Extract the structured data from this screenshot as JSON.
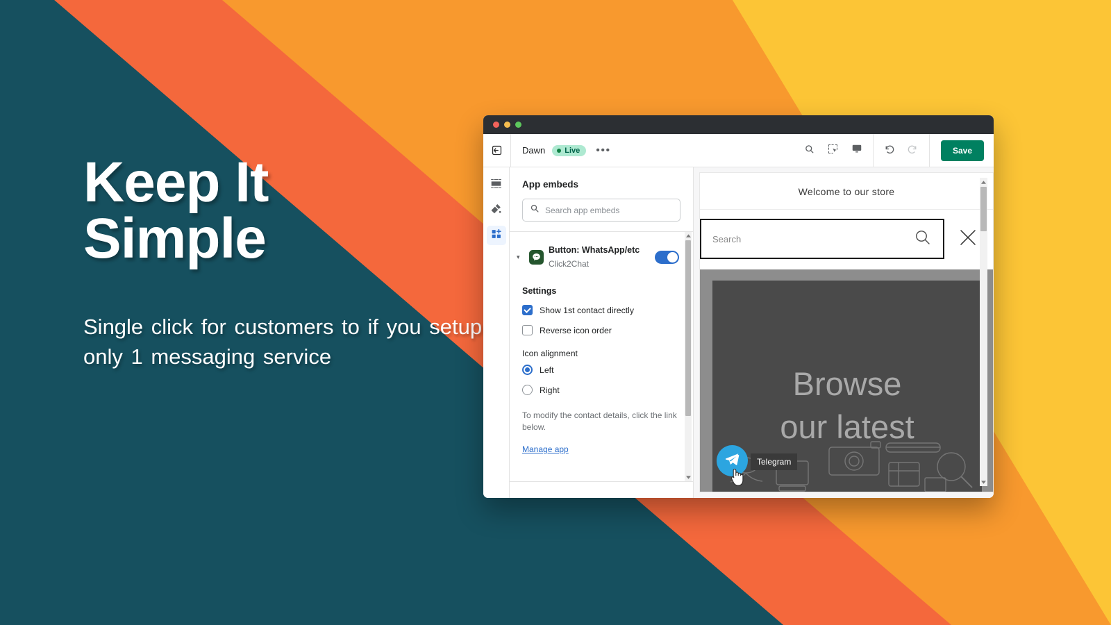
{
  "promo": {
    "title_line1": "Keep It",
    "title_line2": "Simple",
    "subtitle": "Single click for customers to if you setup only 1 messaging service"
  },
  "colors": {
    "bg_teal": "#16505f",
    "stripe_red_orange": "#f4683c",
    "stripe_orange": "#f8992e",
    "stripe_yellow": "#fcc536",
    "accent_blue": "#2c6ecb",
    "save_green": "#008060",
    "live_badge_bg": "#aee9d1",
    "telegram_blue": "#2ca5e0"
  },
  "window": {
    "titlebar_dots": [
      "close-red",
      "minimize-yellow",
      "maximize-green"
    ]
  },
  "topbar": {
    "exit_icon": "exit-editor-icon",
    "theme_name": "Dawn",
    "status_badge": "Live",
    "more_menu": "•••",
    "icons": [
      "search-icon",
      "inspector-icon",
      "desktop-preview-icon",
      "undo-icon",
      "redo-icon"
    ],
    "save_label": "Save"
  },
  "rail": {
    "items": [
      {
        "name": "sections-icon",
        "active": false
      },
      {
        "name": "theme-settings-icon",
        "active": false
      },
      {
        "name": "app-embeds-icon",
        "active": true
      }
    ]
  },
  "sidebar": {
    "title": "App embeds",
    "search": {
      "placeholder": "Search app embeds",
      "value": ""
    },
    "embed": {
      "title": "Button: WhatsApp/etc",
      "subtitle": "Click2Chat",
      "toggle_on": true,
      "caret": "▾"
    },
    "settings_heading": "Settings",
    "checkboxes": [
      {
        "label": "Show 1st contact directly",
        "checked": true
      },
      {
        "label": "Reverse icon order",
        "checked": false
      }
    ],
    "radio_group": {
      "label": "Icon alignment",
      "options": [
        {
          "label": "Left",
          "selected": true
        },
        {
          "label": "Right",
          "selected": false
        }
      ]
    },
    "help_text": "To modify the contact details, click the link below.",
    "manage_link": "Manage app"
  },
  "preview": {
    "announcement": "Welcome to our store",
    "search_placeholder": "Search",
    "search_value": "",
    "close_icon": "close-icon",
    "hero_text_line1": "Browse",
    "hero_text_line2": "our latest",
    "fab": {
      "icon": "telegram-icon",
      "tooltip": "Telegram"
    },
    "cursor": "pointer-hand-cursor"
  }
}
